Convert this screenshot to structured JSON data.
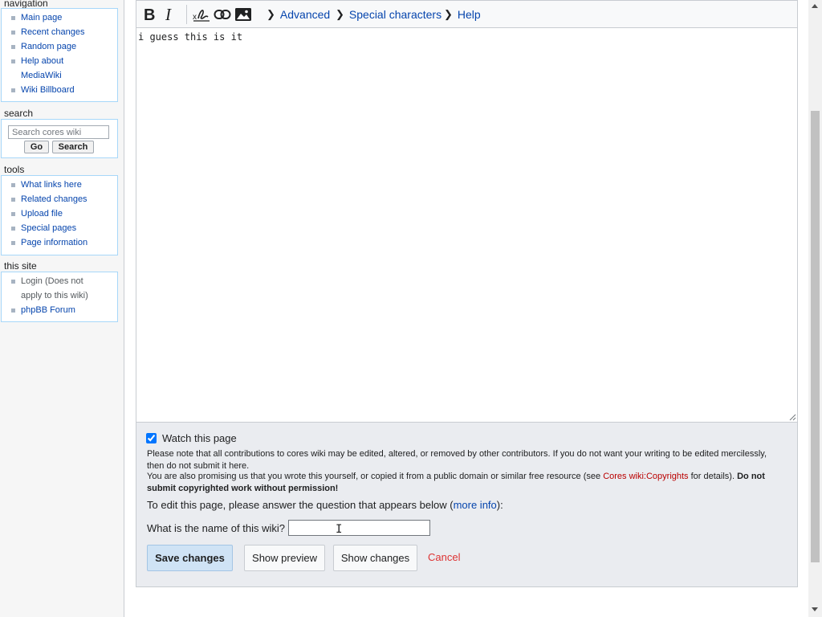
{
  "sidebar": {
    "navigation": {
      "heading": "navigation",
      "items": [
        {
          "label": "Main page"
        },
        {
          "label": "Recent changes"
        },
        {
          "label": "Random page"
        },
        {
          "label": "Help about MediaWiki",
          "line1": "Help about",
          "line2": "MediaWiki"
        },
        {
          "label": "Wiki Billboard"
        }
      ]
    },
    "search": {
      "heading": "search",
      "placeholder": "Search cores wiki",
      "go_label": "Go",
      "search_label": "Search"
    },
    "tools": {
      "heading": "tools",
      "items": [
        {
          "label": "What links here"
        },
        {
          "label": "Related changes"
        },
        {
          "label": "Upload file"
        },
        {
          "label": "Special pages"
        },
        {
          "label": "Page information"
        }
      ]
    },
    "this_site": {
      "heading": "this site",
      "items": [
        {
          "line1": "Login (Does not",
          "line2": "apply to this wiki)"
        },
        {
          "label": "phpBB Forum"
        }
      ]
    }
  },
  "toolbar": {
    "bold_icon": "bold-icon",
    "italic_icon": "italic-icon",
    "signature_icon": "signature-icon",
    "link_icon": "link-icon",
    "image_icon": "image-icon",
    "advanced_label": "Advanced",
    "special_chars_label": "Special characters",
    "help_label": "Help"
  },
  "editor": {
    "text": "i guess this is it"
  },
  "options": {
    "watch_label": "Watch this page",
    "watch_checked": true,
    "notice1": "Please note that all contributions to cores wiki may be edited, altered, or removed by other contributors. If you do not want your writing to be edited mercilessly, then do not submit it here.",
    "notice2_pre": "You are also promising us that you wrote this yourself, or copied it from a public domain or similar free resource (see ",
    "notice2_link": "Cores wiki:Copyrights",
    "notice2_post": " for details). ",
    "notice2_bold": "Do not submit copyrighted work without permission!",
    "question_intro_pre": "To edit this page, please answer the question that appears below (",
    "question_intro_link": "more info",
    "question_intro_post": "):",
    "question_label": "What is the name of this wiki?",
    "answer_value": ""
  },
  "buttons": {
    "save_label": "Save changes",
    "preview_label": "Show preview",
    "changes_label": "Show changes",
    "cancel_label": "Cancel"
  },
  "colors": {
    "link": "#0645ad",
    "redlink": "#ba0000",
    "cancel": "#d33333",
    "primary_button": "#cfe3f5"
  }
}
